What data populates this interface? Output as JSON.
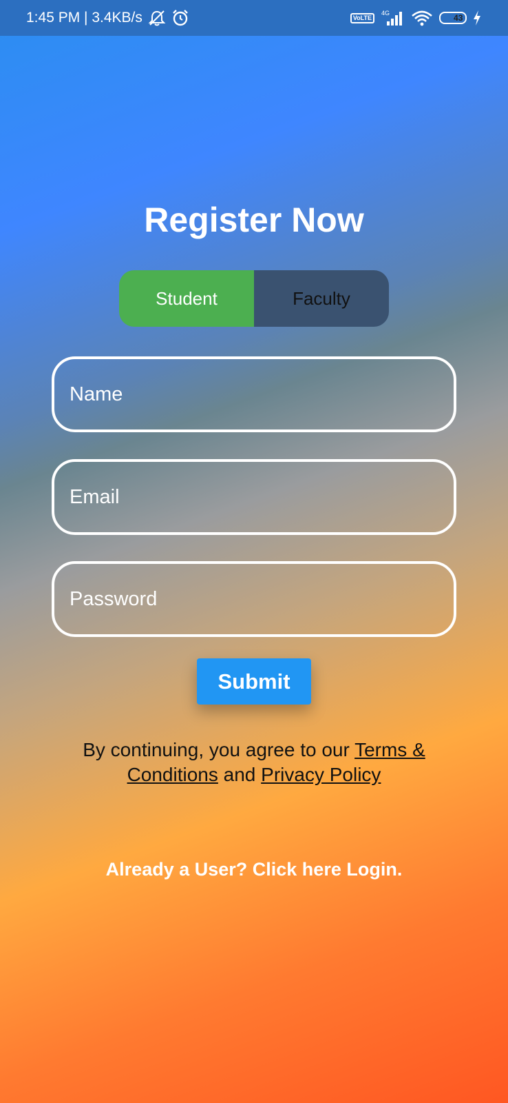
{
  "status_bar": {
    "time_speed": "1:45 PM | 3.4KB/s",
    "icons": [
      "mute-icon",
      "alarm-icon",
      "volte-icon",
      "signal-4g-icon",
      "wifi-icon",
      "battery-icon",
      "charging-icon"
    ],
    "volte_top": "Vo",
    "volte_bottom": "LTE",
    "network": "4G",
    "battery_level": "43",
    "battery_fraction": 0.43,
    "background": "#2c6fc0"
  },
  "form": {
    "title": "Register Now",
    "roles": {
      "student": "Student",
      "faculty": "Faculty",
      "selected": "Student"
    },
    "fields": {
      "name_placeholder": "Name",
      "email_placeholder": "Email",
      "password_placeholder": "Password"
    },
    "submit_label": "Submit",
    "terms": {
      "prefix": "By continuing, you agree to our ",
      "terms_link": "Terms & Conditions",
      "conjunction": " and ",
      "privacy_link": "Privacy Policy"
    },
    "login_link": "Already a User? Click here Login."
  },
  "colors": {
    "accent": "#2196f3",
    "selected_role": "#4caf50",
    "unselected_role": "#3a5270",
    "gradient_top": "#3f86ff",
    "gradient_bottom": "#ff5722"
  }
}
